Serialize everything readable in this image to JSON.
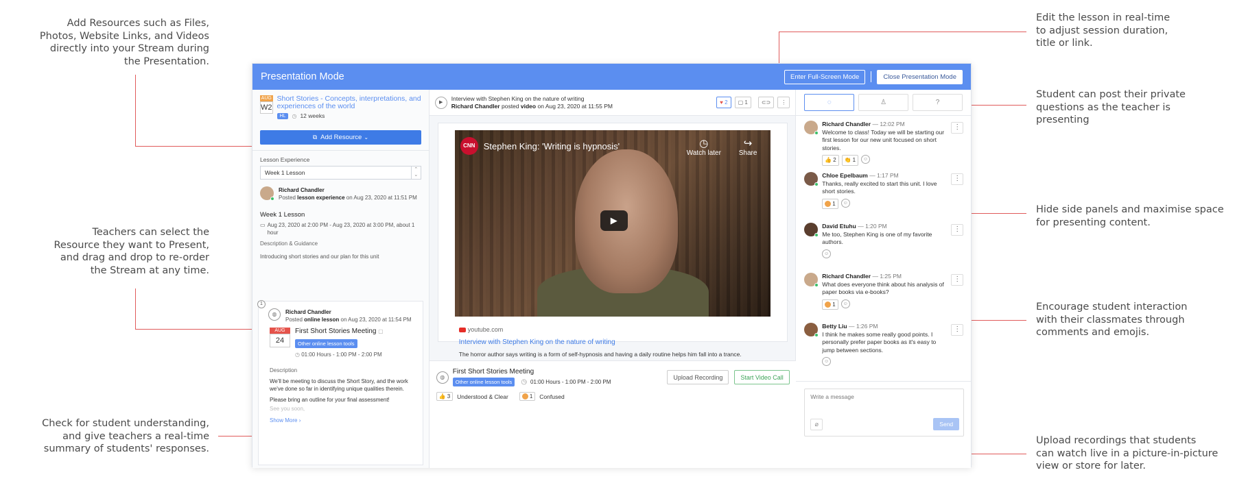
{
  "callouts": {
    "add_resources": "Add Resources such as Files,\nPhotos, Website Links, and Videos\ndirectly into your Stream during\nthe Presentation.",
    "select_resource": "Teachers can select the\nResource they want to Present,\nand drag and drop to re-order\nthe Stream at any time.",
    "check_understanding": "Check for student understanding,\nand give teachers a real-time\nsummary of students' responses.",
    "edit_lesson": "Edit the lesson in real-time\nto adjust session duration,\ntitle or link.",
    "private_questions": "Student can post their private\nquestions as the teacher is\npresenting",
    "hide_panels": "Hide side panels and maximise space\nfor presenting content.",
    "encourage": "Encourage student interaction\nwith their classmates through\ncomments and emojis.",
    "upload_recordings": "Upload recordings that students\ncan watch live in a picture-in-picture\nview or store for later."
  },
  "topbar": {
    "title": "Presentation Mode",
    "fullscreen": "Enter Full-Screen Mode",
    "close": "Close Presentation Mode"
  },
  "left": {
    "course_month": "AUG",
    "course_week": "W2",
    "course_title": "Short Stories - Concepts, interpretations, and experiences of the world",
    "course_level": "HL",
    "course_duration": "12 weeks",
    "add_resource": "Add Resource",
    "lesson_exp_label": "Lesson Experience",
    "lesson_select": "Week 1 Lesson",
    "author": "Richard Chandler",
    "posted_prefix": "Posted",
    "posted_type": "lesson experience",
    "posted_date": "on Aug 23, 2020 at 11:51 PM",
    "lesson_title": "Week 1 Lesson",
    "lesson_dates": "Aug 23, 2020 at 2:00 PM - Aug 23, 2020 at 3:00 PM, about 1 hour",
    "desc_label": "Description & Guidance",
    "desc_text": "Introducing short stories and our plan for this unit",
    "card": {
      "num": "1",
      "author": "Richard Chandler",
      "posted_prefix": "Posted",
      "posted_type": "online lesson",
      "posted_date": "on Aug 23, 2020 at 11:54 PM",
      "month": "AUG",
      "day": "24",
      "meeting_title": "First Short Stories Meeting",
      "tool_tag": "Other online lesson tools",
      "time": "01:00 Hours - 1:00 PM - 2:00 PM",
      "desc_label": "Description",
      "desc1": "We'll be meeting to discuss the Short Story, and the work we've done so far in identifying unique qualities therein.",
      "desc2": "Please bring an outline for your final assessment!",
      "desc3": "See you soon,",
      "show_more": "Show More"
    }
  },
  "mid": {
    "post_title": "Interview with Stephen King on the nature of writing",
    "post_author": "Richard Chandler",
    "post_verb": "posted",
    "post_type": "video",
    "post_date": "on Aug 23, 2020 at 11:55 PM",
    "likes": "2",
    "comments": "1",
    "video_title": "Stephen King: 'Writing is hypnosis'",
    "cnn": "CNN",
    "watch_later": "Watch later",
    "share": "Share",
    "source": "youtube.com",
    "link_title": "Interview with Stephen King on the nature of writing",
    "link_desc": "The horror author says writing is a form of self-hypnosis and having a daily routine helps him fall into a trance.",
    "meeting_title": "First Short Stories Meeting",
    "meeting_tag": "Other online lesson tools",
    "meeting_time": "01:00 Hours - 1:00 PM - 2:00 PM",
    "upload": "Upload Recording",
    "start_call": "Start Video Call",
    "understood_count": "3",
    "understood_label": "Understood & Clear",
    "confused_count": "1",
    "confused_label": "Confused"
  },
  "right": {
    "messages": [
      {
        "name": "Richard Chandler",
        "time": "— 12:02 PM",
        "text": "Welcome to class! Today we will be starting our first lesson for our new unit focused on short stories.",
        "r1": "2",
        "r2": "1"
      },
      {
        "name": "Chloe Epelbaum",
        "time": "— 1:17 PM",
        "text": "Thanks, really excited to start this unit. I love short stories.",
        "r1": "1"
      },
      {
        "name": "David Etuhu",
        "time": "— 1:20 PM",
        "text": "Me too, Stephen King is one of my favorite authors."
      },
      {
        "name": "Richard Chandler",
        "time": "— 1:25 PM",
        "text": "What does everyone think about his analysis of paper books via e-books?",
        "r1": "1"
      },
      {
        "name": "Betty Liu",
        "time": "— 1:26 PM",
        "text": "I think he makes some really good points. I personally prefer paper books as it's easy to jump between sections."
      }
    ],
    "composer_placeholder": "Write a message",
    "send": "Send"
  },
  "colors": {
    "accent": "#5b8ef0",
    "callout_line": "#e05a5a"
  }
}
